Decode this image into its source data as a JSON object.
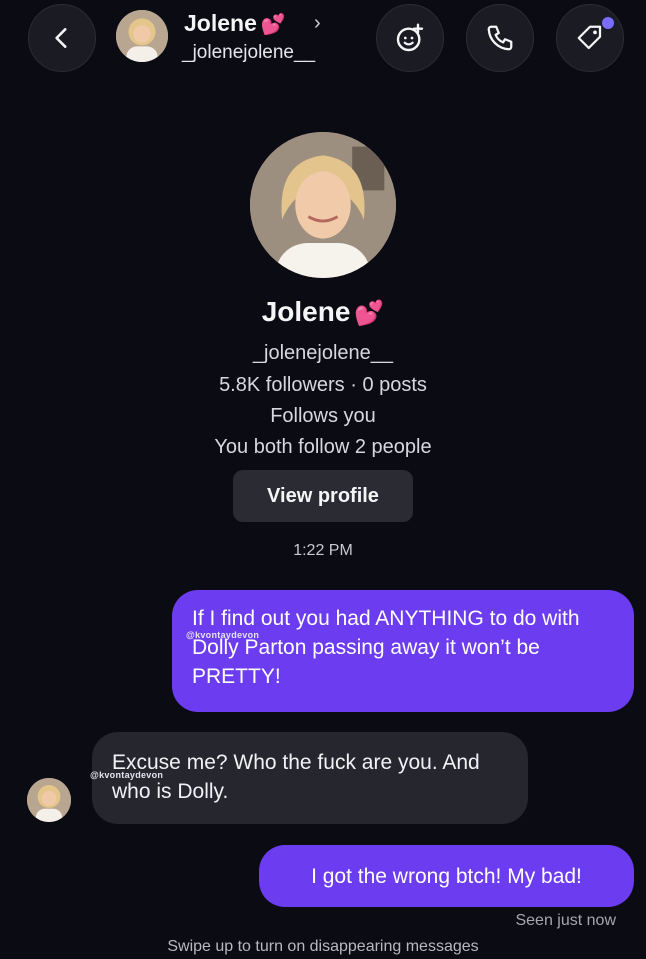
{
  "header": {
    "name": "Jolene",
    "username": "_jolenejolene__",
    "chevron": "›",
    "icons": [
      "back-icon",
      "effects-icon",
      "phone-icon",
      "tag-icon"
    ]
  },
  "profile": {
    "name": "Jolene",
    "username": "_jolenejolene__",
    "stats": "5.8K followers · 0 posts",
    "follows_you": "Follows you",
    "mutual": "You both follow 2 people",
    "view_profile_label": "View profile"
  },
  "thread": {
    "timestamp": "1:22 PM",
    "messages": [
      {
        "from": "me",
        "text": "If I find out you had ANYTHING to do with Dolly Parton passing away it won’t be PRETTY!"
      },
      {
        "from": "them",
        "text": "Excuse me? Who the fuck are you. And who is Dolly."
      },
      {
        "from": "me",
        "text": "I got the wrong btch! My bad!"
      }
    ],
    "watermark": "@kvontaydevon",
    "seen": "Seen just now",
    "footer": "Swipe up to turn on disappearing messages"
  },
  "colors": {
    "background": "#0b0b14",
    "outgoing_bubble": "#6c3cf0",
    "incoming_bubble": "#25262e",
    "heart": "#ff5fa8"
  }
}
